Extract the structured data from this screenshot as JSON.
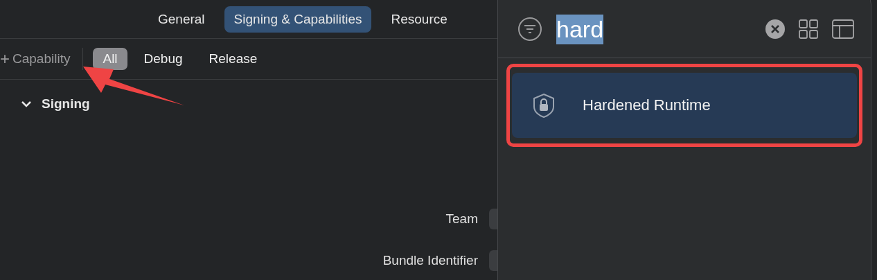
{
  "tabs": [
    {
      "label": "General",
      "selected": false
    },
    {
      "label": "Signing & Capabilities",
      "selected": true
    },
    {
      "label": "Resource",
      "selected": false
    }
  ],
  "toolbar": {
    "add_button": {
      "icon": "+",
      "label": "Capability"
    },
    "filters": [
      {
        "label": "All",
        "selected": true
      },
      {
        "label": "Debug",
        "selected": false
      },
      {
        "label": "Release",
        "selected": false
      }
    ]
  },
  "section": {
    "title": "Signing",
    "expanded": true,
    "fields": [
      {
        "label": "Team"
      },
      {
        "label": "Bundle Identifier"
      }
    ]
  },
  "library": {
    "search": {
      "value": "hard",
      "text_selected": true
    },
    "results": [
      {
        "label": "Hardened Runtime",
        "selected": true,
        "highlighted": true
      }
    ]
  },
  "annotation_arrow": true
}
